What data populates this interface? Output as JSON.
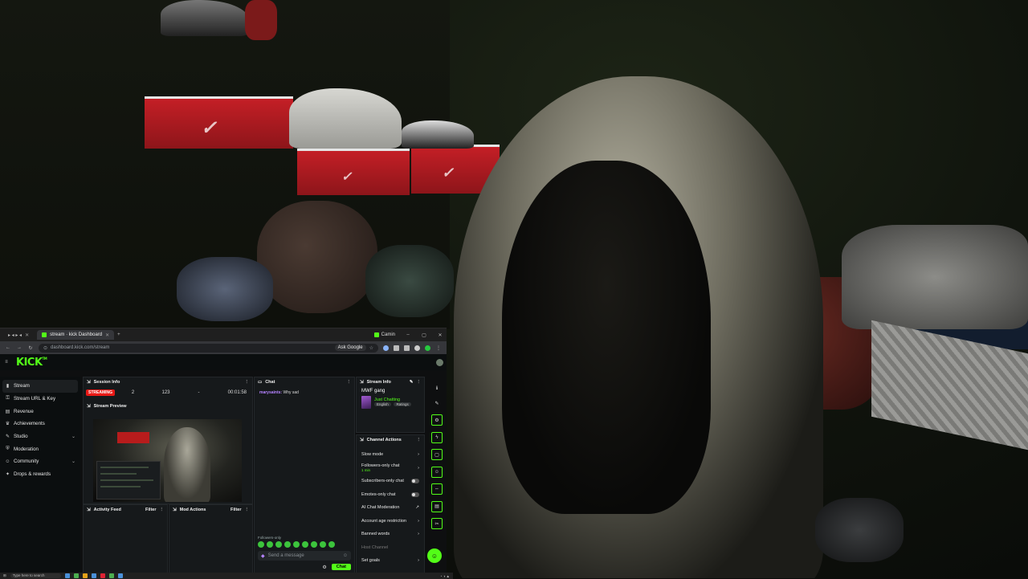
{
  "browser": {
    "tabs": [
      {
        "label": "▸ ◂ ▸ ◂",
        "active": false
      },
      {
        "label": "stream · kick Dashboard",
        "active": true
      }
    ],
    "new_tab": "+",
    "profile": "Camin",
    "url": "dashboard.kick.com/stream",
    "ask_google": "Ask Google"
  },
  "sidebar": {
    "items": [
      {
        "label": "Stream",
        "icon": "stream-icon",
        "active": true
      },
      {
        "label": "Stream URL & Key",
        "icon": "key-icon"
      },
      {
        "label": "Revenue",
        "icon": "revenue-icon"
      },
      {
        "label": "Achievements",
        "icon": "trophy-icon"
      },
      {
        "label": "Studio",
        "icon": "studio-icon",
        "expandable": true
      },
      {
        "label": "Moderation",
        "icon": "shield-icon"
      },
      {
        "label": "Community",
        "icon": "community-icon",
        "expandable": true
      },
      {
        "label": "Drops & rewards",
        "icon": "gift-icon"
      }
    ]
  },
  "session": {
    "title": "Session Info",
    "status": "STREAMING",
    "viewers": "2",
    "followers": "123",
    "subs": "-",
    "duration": "00:01:58"
  },
  "preview": {
    "title": "Stream Preview"
  },
  "activity": {
    "title": "Activity Feed",
    "filter": "Filter"
  },
  "mod_actions": {
    "title": "Mod Actions",
    "filter": "Filter"
  },
  "chat": {
    "title": "Chat",
    "messages": [
      {
        "user": "marysaints:",
        "text": "Why sad"
      }
    ],
    "note": "Followers-only",
    "placeholder": "Send a message",
    "send": "Chat"
  },
  "stream_info": {
    "title": "Stream Info",
    "stream_title": "MWF gang",
    "category": "Just Chatting",
    "tags": [
      "English",
      "Ratings"
    ]
  },
  "channel_actions": {
    "title": "Channel Actions",
    "items": [
      {
        "label": "Slow mode",
        "kind": "chevron"
      },
      {
        "label": "Followers-only chat",
        "sub": "1 min",
        "kind": "chevron"
      },
      {
        "label": "Subscribers-only chat",
        "kind": "toggle"
      },
      {
        "label": "Emotes-only chat",
        "kind": "toggle"
      },
      {
        "label": "AI Chat Moderation",
        "kind": "external"
      },
      {
        "label": "Account age restriction",
        "kind": "chevron"
      },
      {
        "label": "Banned words",
        "kind": "chevron"
      },
      {
        "label": "Host Channel",
        "kind": "dim"
      },
      {
        "label": "Set goals",
        "kind": "chevron"
      }
    ]
  },
  "taskbar": {
    "search": "Type here to search"
  },
  "colors": {
    "kick_green": "#53fc18",
    "live_red": "#e91916",
    "panel": "#16191b"
  }
}
